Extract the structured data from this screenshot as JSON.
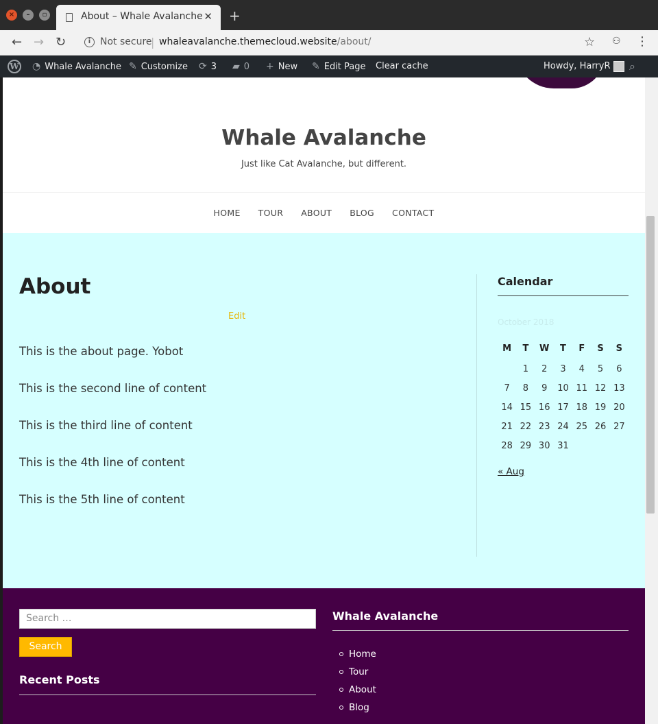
{
  "browser": {
    "tab_title": "About – Whale Avalanche",
    "new_tab": "+",
    "security": "Not secure",
    "url_host": "whaleavalanche.themecloud.website",
    "url_path": "/about/"
  },
  "admin_bar": {
    "site_name": "Whale Avalanche",
    "customize": "Customize",
    "updates_count": "3",
    "comments_count": "0",
    "new": "New",
    "edit_page": "Edit Page",
    "clear_cache": "Clear cache",
    "howdy": "Howdy, HarryR"
  },
  "site": {
    "title": "Whale Avalanche",
    "tagline": "Just like Cat Avalanche, but different."
  },
  "nav": [
    "HOME",
    "TOUR",
    "ABOUT",
    "BLOG",
    "CONTACT"
  ],
  "content": {
    "title": "About",
    "edit": "Edit",
    "paragraphs": [
      "This is the about page. Yobot",
      "This is the second line of content",
      "This is the third line of content",
      "This is the 4th line of content",
      "This is the 5th line of content"
    ]
  },
  "sidebar": {
    "calendar_title": "Calendar",
    "calendar_caption": "October 2018",
    "weekdays": [
      "M",
      "T",
      "W",
      "T",
      "F",
      "S",
      "S"
    ],
    "weeks": [
      [
        "",
        "1",
        "2",
        "3",
        "4",
        "5",
        "6"
      ],
      [
        "7",
        "8",
        "9",
        "10",
        "11",
        "12",
        "13"
      ],
      [
        "14",
        "15",
        "16",
        "17",
        "18",
        "19",
        "20"
      ],
      [
        "21",
        "22",
        "23",
        "24",
        "25",
        "26",
        "27"
      ],
      [
        "28",
        "29",
        "30",
        "31",
        "",
        "",
        ""
      ]
    ],
    "prev_month": "« Aug"
  },
  "footer": {
    "search_placeholder": "Search …",
    "search_button": "Search",
    "recent_posts_title": "Recent Posts",
    "menu_title": "Whale Avalanche",
    "menu_items": [
      "Home",
      "Tour",
      "About",
      "Blog"
    ]
  },
  "colors": {
    "content_bg": "#d6ffff",
    "footer_bg": "#450045",
    "accent": "#ffb900",
    "admin_bar": "#23282d"
  }
}
